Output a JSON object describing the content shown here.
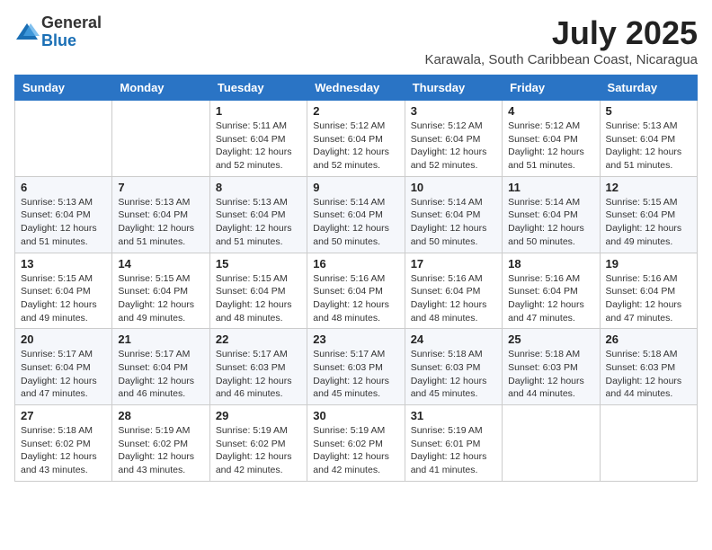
{
  "logo": {
    "general": "General",
    "blue": "Blue"
  },
  "header": {
    "month": "July 2025",
    "location": "Karawala, South Caribbean Coast, Nicaragua"
  },
  "weekdays": [
    "Sunday",
    "Monday",
    "Tuesday",
    "Wednesday",
    "Thursday",
    "Friday",
    "Saturday"
  ],
  "weeks": [
    [
      {
        "day": "",
        "info": ""
      },
      {
        "day": "",
        "info": ""
      },
      {
        "day": "1",
        "info": "Sunrise: 5:11 AM\nSunset: 6:04 PM\nDaylight: 12 hours and 52 minutes."
      },
      {
        "day": "2",
        "info": "Sunrise: 5:12 AM\nSunset: 6:04 PM\nDaylight: 12 hours and 52 minutes."
      },
      {
        "day": "3",
        "info": "Sunrise: 5:12 AM\nSunset: 6:04 PM\nDaylight: 12 hours and 52 minutes."
      },
      {
        "day": "4",
        "info": "Sunrise: 5:12 AM\nSunset: 6:04 PM\nDaylight: 12 hours and 51 minutes."
      },
      {
        "day": "5",
        "info": "Sunrise: 5:13 AM\nSunset: 6:04 PM\nDaylight: 12 hours and 51 minutes."
      }
    ],
    [
      {
        "day": "6",
        "info": "Sunrise: 5:13 AM\nSunset: 6:04 PM\nDaylight: 12 hours and 51 minutes."
      },
      {
        "day": "7",
        "info": "Sunrise: 5:13 AM\nSunset: 6:04 PM\nDaylight: 12 hours and 51 minutes."
      },
      {
        "day": "8",
        "info": "Sunrise: 5:13 AM\nSunset: 6:04 PM\nDaylight: 12 hours and 51 minutes."
      },
      {
        "day": "9",
        "info": "Sunrise: 5:14 AM\nSunset: 6:04 PM\nDaylight: 12 hours and 50 minutes."
      },
      {
        "day": "10",
        "info": "Sunrise: 5:14 AM\nSunset: 6:04 PM\nDaylight: 12 hours and 50 minutes."
      },
      {
        "day": "11",
        "info": "Sunrise: 5:14 AM\nSunset: 6:04 PM\nDaylight: 12 hours and 50 minutes."
      },
      {
        "day": "12",
        "info": "Sunrise: 5:15 AM\nSunset: 6:04 PM\nDaylight: 12 hours and 49 minutes."
      }
    ],
    [
      {
        "day": "13",
        "info": "Sunrise: 5:15 AM\nSunset: 6:04 PM\nDaylight: 12 hours and 49 minutes."
      },
      {
        "day": "14",
        "info": "Sunrise: 5:15 AM\nSunset: 6:04 PM\nDaylight: 12 hours and 49 minutes."
      },
      {
        "day": "15",
        "info": "Sunrise: 5:15 AM\nSunset: 6:04 PM\nDaylight: 12 hours and 48 minutes."
      },
      {
        "day": "16",
        "info": "Sunrise: 5:16 AM\nSunset: 6:04 PM\nDaylight: 12 hours and 48 minutes."
      },
      {
        "day": "17",
        "info": "Sunrise: 5:16 AM\nSunset: 6:04 PM\nDaylight: 12 hours and 48 minutes."
      },
      {
        "day": "18",
        "info": "Sunrise: 5:16 AM\nSunset: 6:04 PM\nDaylight: 12 hours and 47 minutes."
      },
      {
        "day": "19",
        "info": "Sunrise: 5:16 AM\nSunset: 6:04 PM\nDaylight: 12 hours and 47 minutes."
      }
    ],
    [
      {
        "day": "20",
        "info": "Sunrise: 5:17 AM\nSunset: 6:04 PM\nDaylight: 12 hours and 47 minutes."
      },
      {
        "day": "21",
        "info": "Sunrise: 5:17 AM\nSunset: 6:04 PM\nDaylight: 12 hours and 46 minutes."
      },
      {
        "day": "22",
        "info": "Sunrise: 5:17 AM\nSunset: 6:03 PM\nDaylight: 12 hours and 46 minutes."
      },
      {
        "day": "23",
        "info": "Sunrise: 5:17 AM\nSunset: 6:03 PM\nDaylight: 12 hours and 45 minutes."
      },
      {
        "day": "24",
        "info": "Sunrise: 5:18 AM\nSunset: 6:03 PM\nDaylight: 12 hours and 45 minutes."
      },
      {
        "day": "25",
        "info": "Sunrise: 5:18 AM\nSunset: 6:03 PM\nDaylight: 12 hours and 44 minutes."
      },
      {
        "day": "26",
        "info": "Sunrise: 5:18 AM\nSunset: 6:03 PM\nDaylight: 12 hours and 44 minutes."
      }
    ],
    [
      {
        "day": "27",
        "info": "Sunrise: 5:18 AM\nSunset: 6:02 PM\nDaylight: 12 hours and 43 minutes."
      },
      {
        "day": "28",
        "info": "Sunrise: 5:19 AM\nSunset: 6:02 PM\nDaylight: 12 hours and 43 minutes."
      },
      {
        "day": "29",
        "info": "Sunrise: 5:19 AM\nSunset: 6:02 PM\nDaylight: 12 hours and 42 minutes."
      },
      {
        "day": "30",
        "info": "Sunrise: 5:19 AM\nSunset: 6:02 PM\nDaylight: 12 hours and 42 minutes."
      },
      {
        "day": "31",
        "info": "Sunrise: 5:19 AM\nSunset: 6:01 PM\nDaylight: 12 hours and 41 minutes."
      },
      {
        "day": "",
        "info": ""
      },
      {
        "day": "",
        "info": ""
      }
    ]
  ]
}
